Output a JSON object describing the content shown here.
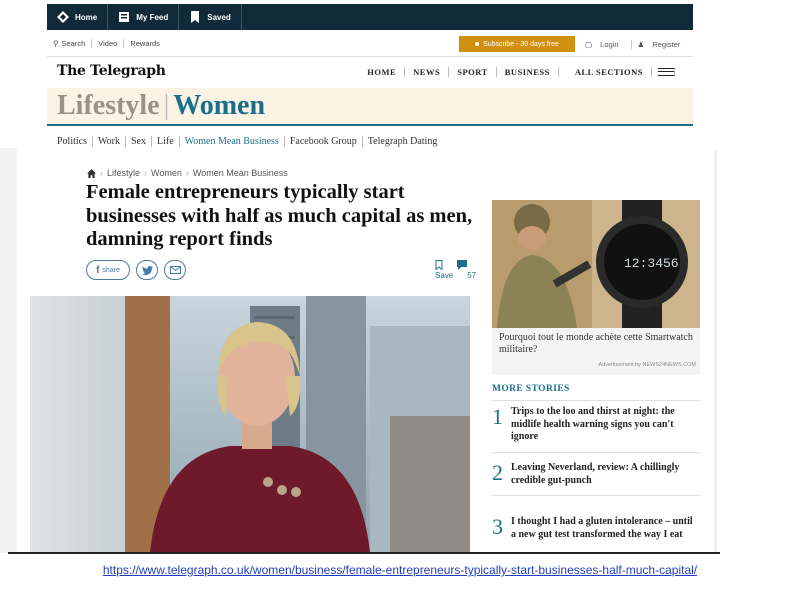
{
  "topbar": {
    "home": "Home",
    "feed": "My Feed",
    "saved": "Saved"
  },
  "util": {
    "search": "Search",
    "video": "Video",
    "rewards": "Rewards",
    "subscribe": "Subscribe - 30 days free",
    "login": "Login",
    "register": "Register"
  },
  "masthead": {
    "logo": "The Telegraph",
    "nav": [
      "HOME",
      "NEWS",
      "SPORT",
      "BUSINESS",
      "ALL SECTIONS"
    ]
  },
  "section": {
    "lifestyle": "Lifestyle",
    "women": "Women"
  },
  "subnav": [
    "Politics",
    "Work",
    "Sex",
    "Life",
    "Women Mean Business",
    "Facebook Group",
    "Telegraph Dating"
  ],
  "breadcrumb": [
    "Lifestyle",
    "Women",
    "Women Mean Business"
  ],
  "article": {
    "headline": "Female entrepreneurs typically start businesses with half as much capital as men, damning report finds",
    "share_label": "share",
    "save_label": "Save",
    "comment_count": "57"
  },
  "ad": {
    "text": "Pourquoi tout le monde achète cette Smartwatch militaire?",
    "credit": "Advertisement by NEWS24NEWS.COM",
    "watch_time": "12:3456"
  },
  "more_stories": {
    "heading": "MORE STORIES",
    "items": [
      {
        "num": "1",
        "title": "Trips to the loo and thirst at night: the midlife health warning signs you can't ignore"
      },
      {
        "num": "2",
        "title": "Leaving Neverland, review: A chillingly credible gut-punch"
      },
      {
        "num": "3",
        "title": "I thought I had a gluten intolerance – until a new gut test transformed the way I eat"
      }
    ]
  },
  "source_url": "https://www.telegraph.co.uk/women/business/female-entrepreneurs-typically-start-businesses-half-much-capital/",
  "colors": {
    "topbar": "#112a3a",
    "accent": "#1a6f8c",
    "subscribe": "#d1900f",
    "section_bg": "#fbf3e3"
  }
}
